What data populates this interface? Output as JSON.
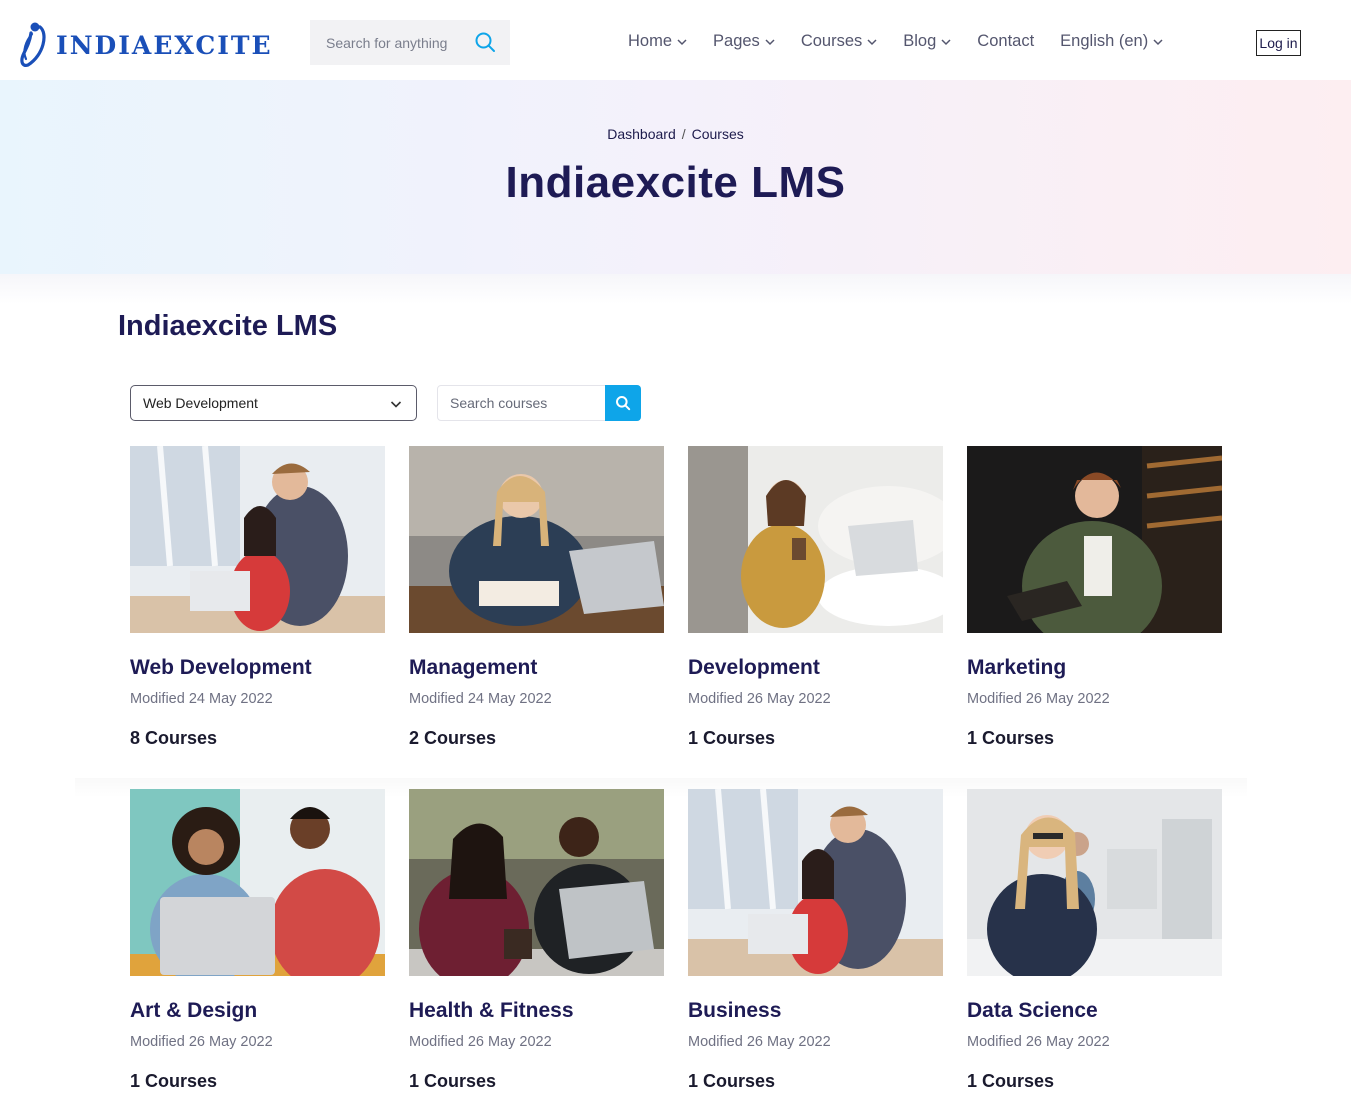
{
  "header": {
    "logo_text": "INDIAEXCITE",
    "search_placeholder": "Search for anything",
    "nav": [
      {
        "label": "Home",
        "has_dropdown": true
      },
      {
        "label": "Pages",
        "has_dropdown": true
      },
      {
        "label": "Courses",
        "has_dropdown": true
      },
      {
        "label": "Blog",
        "has_dropdown": true
      },
      {
        "label": "Contact",
        "has_dropdown": false
      },
      {
        "label": "English (en)",
        "has_dropdown": true
      }
    ],
    "login_label": "Log in"
  },
  "banner": {
    "breadcrumb": [
      "Dashboard",
      "Courses"
    ],
    "breadcrumb_separator": "/",
    "title": "Indiaexcite LMS"
  },
  "main": {
    "heading": "Indiaexcite LMS",
    "category_select_value": "Web Development",
    "course_search_placeholder": "Search courses",
    "categories": [
      {
        "name": "Web Development",
        "modified": "Modified 24 May 2022",
        "count": "8 Courses",
        "image": "photo-woman-laptop-man-leaning"
      },
      {
        "name": "Management",
        "modified": "Modified 24 May 2022",
        "count": "2 Courses",
        "image": "photo-woman-writing-notebook"
      },
      {
        "name": "Development",
        "modified": "Modified 26 May 2022",
        "count": "1 Courses",
        "image": "photo-woman-coffee-laptop"
      },
      {
        "name": "Marketing",
        "modified": "Modified 26 May 2022",
        "count": "1 Courses",
        "image": "photo-man-reading-notebook"
      },
      {
        "name": "Art & Design",
        "modified": "Modified 26 May 2022",
        "count": "1 Courses",
        "image": "photo-couple-laptop-drinks"
      },
      {
        "name": "Health & Fitness",
        "modified": "Modified 26 May 2022",
        "count": "1 Courses",
        "image": "photo-two-people-high-five"
      },
      {
        "name": "Business",
        "modified": "Modified 26 May 2022",
        "count": "1 Courses",
        "image": "photo-woman-laptop-man-leaning"
      },
      {
        "name": "Data Science",
        "modified": "Modified 26 May 2022",
        "count": "1 Courses",
        "image": "photo-woman-office-computers"
      }
    ]
  },
  "colors": {
    "brand_blue": "#1a4fb8",
    "heading_navy": "#1e1b55",
    "accent_cyan": "#0ea5e9"
  }
}
